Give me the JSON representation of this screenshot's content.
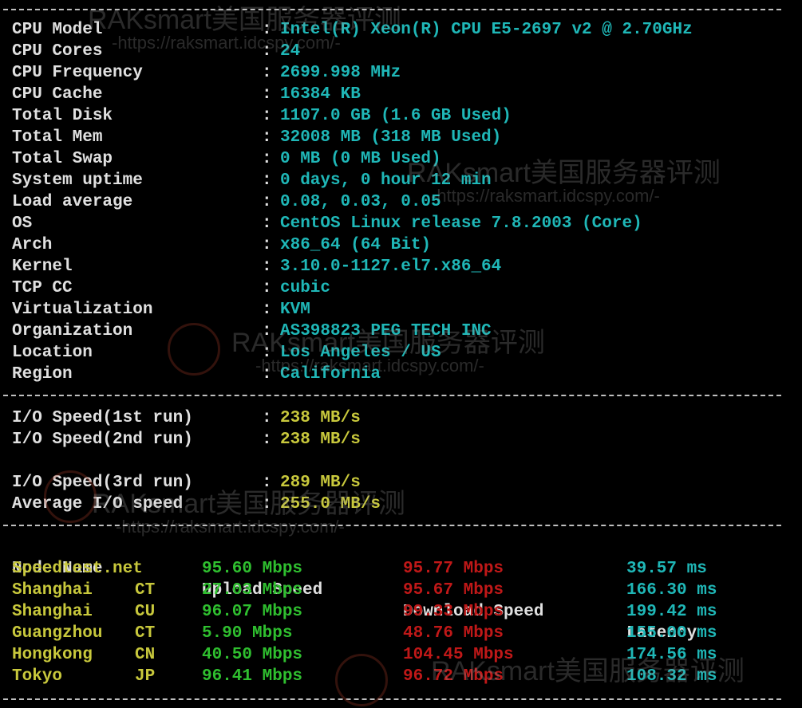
{
  "system": [
    {
      "label": "CPU Model",
      "value": "Intel(R) Xeon(R) CPU E5-2697 v2 @ 2.70GHz"
    },
    {
      "label": "CPU Cores",
      "value": "24"
    },
    {
      "label": "CPU Frequency",
      "value": "2699.998 MHz"
    },
    {
      "label": "CPU Cache",
      "value": "16384 KB"
    },
    {
      "label": "Total Disk",
      "value": "1107.0 GB (1.6 GB Used)"
    },
    {
      "label": "Total Mem",
      "value": "32008 MB (318 MB Used)"
    },
    {
      "label": "Total Swap",
      "value": "0 MB (0 MB Used)"
    },
    {
      "label": "System uptime",
      "value": "0 days, 0 hour 12 min"
    },
    {
      "label": "Load average",
      "value": "0.08, 0.03, 0.05"
    },
    {
      "label": "OS",
      "value": "CentOS Linux release 7.8.2003 (Core)"
    },
    {
      "label": "Arch",
      "value": "x86_64 (64 Bit)"
    },
    {
      "label": "Kernel",
      "value": "3.10.0-1127.el7.x86_64"
    },
    {
      "label": "TCP CC",
      "value": "cubic"
    },
    {
      "label": "Virtualization",
      "value": "KVM"
    },
    {
      "label": "Organization",
      "value": "AS398823 PEG TECH INC"
    },
    {
      "label": "Location",
      "value": "Los Angeles / US"
    },
    {
      "label": "Region",
      "value": "California"
    }
  ],
  "colon": ":",
  "io": [
    {
      "label": "I/O Speed(1st run)",
      "value": "238 MB/s"
    },
    {
      "label": "I/O Speed(2nd run)",
      "value": "238 MB/s"
    },
    {
      "label": "I/O Speed(3rd run)",
      "value": "289 MB/s"
    },
    {
      "label": "Average I/O speed",
      "value": "255.0 MB/s"
    }
  ],
  "speed_header": {
    "node": "Node Name",
    "upload": "Upload Speed",
    "download": "Download Speed",
    "latency": "Latency"
  },
  "speed_rows": [
    {
      "node": "Speedtest.net",
      "isp": "",
      "upload": "95.60 Mbps",
      "download": "95.77 Mbps",
      "latency": "39.57 ms"
    },
    {
      "node": "Shanghai",
      "isp": "CT",
      "upload": "27.03 Mbps",
      "download": "95.67 Mbps",
      "latency": "166.30 ms"
    },
    {
      "node": "Shanghai",
      "isp": "CU",
      "upload": "96.07 Mbps",
      "download": "99.33 Mbps",
      "latency": "199.42 ms"
    },
    {
      "node": "Guangzhou",
      "isp": "CT",
      "upload": "5.90 Mbps",
      "download": "48.76 Mbps",
      "latency": "155.00 ms"
    },
    {
      "node": "Hongkong",
      "isp": "CN",
      "upload": "40.50 Mbps",
      "download": "104.45 Mbps",
      "latency": "174.56 ms"
    },
    {
      "node": "Tokyo",
      "isp": "JP",
      "upload": "96.41 Mbps",
      "download": "96.72 Mbps",
      "latency": "108.32 ms"
    }
  ],
  "watermark": {
    "brand": "RAKsmart美国服务器评测",
    "url": "-https://raksmart.idcspy.com/-"
  },
  "colors": {
    "label": "#e0e0e0",
    "cyan": "#1fb7b7",
    "yellow": "#c8c83c",
    "green": "#2fbf2f",
    "red": "#c01818",
    "background": "#000000"
  }
}
